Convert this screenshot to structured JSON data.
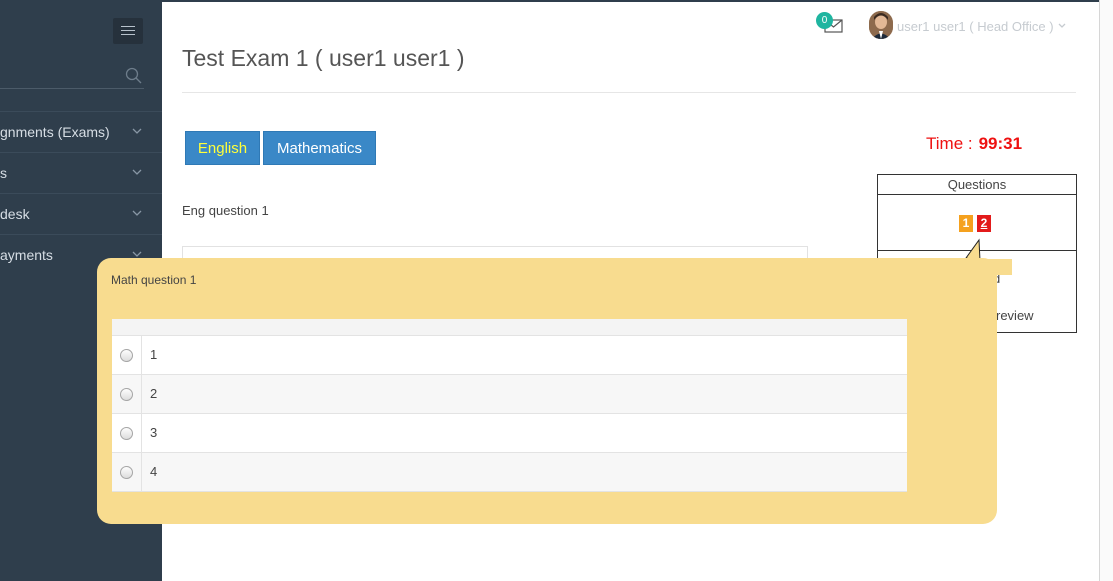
{
  "sidebar": {
    "items": [
      {
        "label": "gnments (Exams)",
        "icon": "chevron-down-icon"
      },
      {
        "label": "s",
        "icon": "chevron-down-icon"
      },
      {
        "label": "desk",
        "icon": "chevron-down-icon"
      },
      {
        "label": "ayments",
        "icon": "chevron-down-icon"
      }
    ]
  },
  "header": {
    "mail_count": "0",
    "user_name": "user1 user1 ( Head Office )"
  },
  "page": {
    "title": "Test Exam 1 ( user1 user1 )",
    "tabs": [
      {
        "label": "English",
        "active": true
      },
      {
        "label": "Mathematics",
        "active": false
      }
    ],
    "timer_label": "Time :",
    "timer_value": "99:31"
  },
  "questions_panel": {
    "heading": "Questions",
    "numbers": [
      "1",
      "2"
    ],
    "legend_partial": [
      "d",
      "review"
    ],
    "colors": {
      "answered": "#f5a11e",
      "current": "#e31b1b"
    }
  },
  "english_question": {
    "text": "Eng question 1"
  },
  "math_overlay": {
    "question": "Math question 1",
    "options": [
      "1",
      "2",
      "3",
      "4"
    ],
    "background": "#f8dc8f"
  }
}
